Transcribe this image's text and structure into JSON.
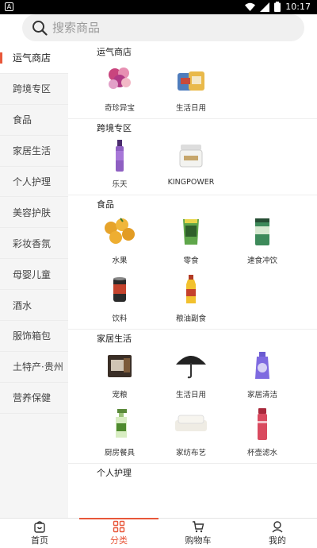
{
  "status_bar": {
    "time": "10:17",
    "left_glyph": "A"
  },
  "search": {
    "placeholder": "搜索商品"
  },
  "sidebar": {
    "items": [
      {
        "label": "运气商店",
        "active": true
      },
      {
        "label": "跨境专区"
      },
      {
        "label": "食品"
      },
      {
        "label": "家居生活"
      },
      {
        "label": "个人护理"
      },
      {
        "label": "美容护肤"
      },
      {
        "label": "彩妆香氛"
      },
      {
        "label": "母婴儿童"
      },
      {
        "label": "酒水"
      },
      {
        "label": "服饰箱包"
      },
      {
        "label": "土特产·贵州"
      },
      {
        "label": "营养保健"
      }
    ]
  },
  "sections": [
    {
      "title": "运气商店",
      "items": [
        {
          "label": "奇珍异宝",
          "icon": "flower-toy-icon"
        },
        {
          "label": "生活日用",
          "icon": "household-bag-icon"
        }
      ]
    },
    {
      "title": "跨境专区",
      "items": [
        {
          "label": "乐天",
          "icon": "purple-bottle-icon"
        },
        {
          "label": "KINGPOWER",
          "icon": "cream-jar-icon"
        }
      ]
    },
    {
      "title": "食品",
      "items": [
        {
          "label": "水果",
          "icon": "fruit-icon"
        },
        {
          "label": "零食",
          "icon": "snack-bag-icon"
        },
        {
          "label": "速食冲饮",
          "icon": "drink-pack-icon"
        },
        {
          "label": "饮料",
          "icon": "can-icon"
        },
        {
          "label": "粮油副食",
          "icon": "oil-bottle-icon"
        }
      ]
    },
    {
      "title": "家居生活",
      "items": [
        {
          "label": "宠粮",
          "icon": "pet-food-icon"
        },
        {
          "label": "生活日用",
          "icon": "umbrella-icon"
        },
        {
          "label": "家居清洁",
          "icon": "cleaner-bottle-icon"
        },
        {
          "label": "厨房餐具",
          "icon": "spray-bottle-icon"
        },
        {
          "label": "家纺布艺",
          "icon": "towel-icon"
        },
        {
          "label": "杯壶滤水",
          "icon": "thermos-icon"
        }
      ]
    },
    {
      "title": "个人护理",
      "items": []
    }
  ],
  "tabbar": {
    "items": [
      {
        "label": "首页",
        "icon": "home-bag-icon"
      },
      {
        "label": "分类",
        "icon": "category-grid-icon",
        "active": true
      },
      {
        "label": "购物车",
        "icon": "cart-icon"
      },
      {
        "label": "我的",
        "icon": "user-icon"
      }
    ]
  }
}
